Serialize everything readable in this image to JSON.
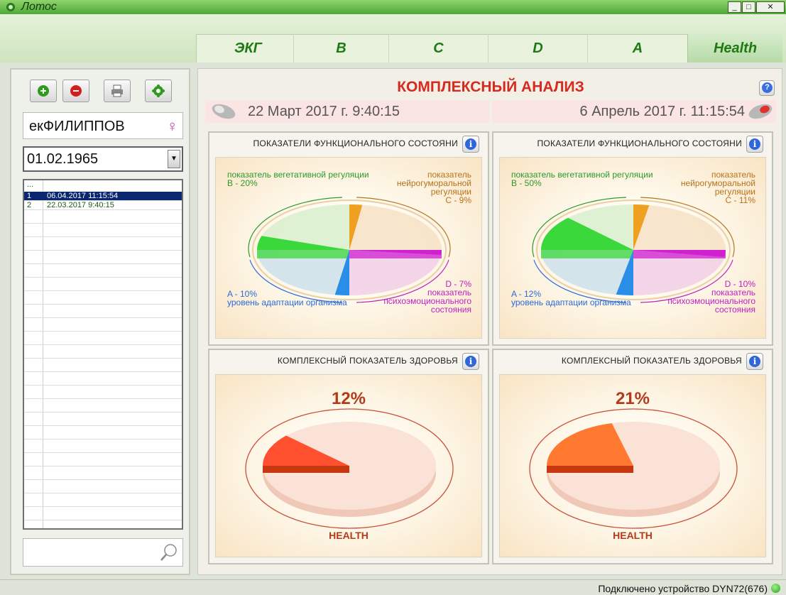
{
  "window": {
    "title": "Лотос"
  },
  "tabs": [
    {
      "label": "ЭКГ"
    },
    {
      "label": "B"
    },
    {
      "label": "C"
    },
    {
      "label": "D"
    },
    {
      "label": "A"
    },
    {
      "label": "Health"
    }
  ],
  "sidebar": {
    "patient_name": "екФИЛИППОВ",
    "dob": "01.02.1965",
    "list_header": "...",
    "records": [
      {
        "num": "1",
        "date": "06.04.2017 11:15:54"
      },
      {
        "num": "2",
        "date": "22.03.2017 9:40:15"
      }
    ]
  },
  "main": {
    "title": "КОМПЛЕКСНЫЙ АНАЛИЗ",
    "date_left": "22 Март 2017 г. 9:40:15",
    "date_right": "6 Апрель 2017 г. 11:15:54",
    "func_title": "ПОКАЗАТЕЛИ ФУНКЦИОНАЛЬНОГО СОСТОЯНИ",
    "health_title": "КОМПЛЕКСНЫЙ ПОКАЗАТЕЛЬ ЗДОРОВЬЯ",
    "health_label": "HEALTH",
    "left": {
      "b_text": "показатель вегетативной регуляции",
      "b_value": "B - 20%",
      "c_text": "показатель нейрогуморальной регуляции",
      "c_value": "C - 9%",
      "d_value": "D - 7%",
      "d_text": "показатель психоэмоционального состояния",
      "a_value": "A - 10%",
      "a_text": "уровень адаптации организма",
      "health_pct": "12%"
    },
    "right": {
      "b_text": "показатель вегетативной регуляции",
      "b_value": "B - 50%",
      "c_text": "показатель нейрогуморальной регуляции",
      "c_value": "C - 11%",
      "d_value": "D - 10%",
      "d_text": "показатель психоэмоционального состояния",
      "a_value": "A - 12%",
      "a_text": "уровень адаптации организма",
      "health_pct": "21%"
    }
  },
  "status": {
    "text": "Подключено устройство DYN72(676)"
  },
  "chart_data": [
    {
      "type": "pie",
      "title": "ПОКАЗАТЕЛИ ФУНКЦИОНАЛЬНОГО СОСТОЯНИ",
      "categories": [
        "B",
        "C",
        "D",
        "A"
      ],
      "values": [
        20,
        9,
        7,
        10
      ],
      "colors": [
        "#3bd83b",
        "#f0a020",
        "#d020d0",
        "#2a8ee8"
      ]
    },
    {
      "type": "pie",
      "title": "ПОКАЗАТЕЛИ ФУНКЦИОНАЛЬНОГО СОСТОЯНИ",
      "categories": [
        "B",
        "C",
        "D",
        "A"
      ],
      "values": [
        50,
        11,
        10,
        12
      ],
      "colors": [
        "#3bd83b",
        "#f0a020",
        "#d020d0",
        "#2a8ee8"
      ]
    },
    {
      "type": "pie",
      "title": "КОМПЛЕКСНЫЙ ПОКАЗАТЕЛЬ ЗДОРОВЬЯ",
      "categories": [
        "HEALTH"
      ],
      "values": [
        12
      ],
      "colors": [
        "#ff5030"
      ]
    },
    {
      "type": "pie",
      "title": "КОМПЛЕКСНЫЙ ПОКАЗАТЕЛЬ ЗДОРОВЬЯ",
      "categories": [
        "HEALTH"
      ],
      "values": [
        21
      ],
      "colors": [
        "#ff7a30"
      ]
    }
  ]
}
